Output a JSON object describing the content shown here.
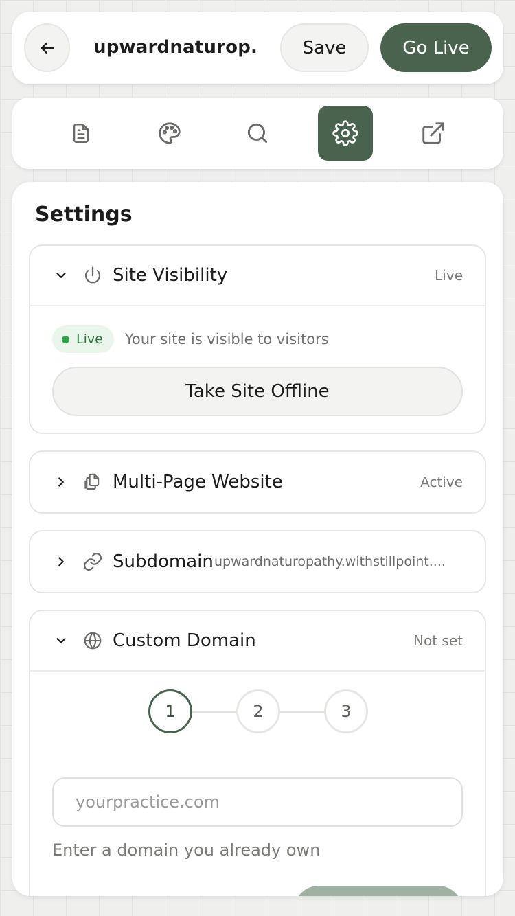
{
  "topbar": {
    "site_name": "upwardnaturop...",
    "save_label": "Save",
    "go_live_label": "Go Live"
  },
  "toolbar": {
    "tools": [
      {
        "icon": "document-icon",
        "active": false
      },
      {
        "icon": "palette-icon",
        "active": false
      },
      {
        "icon": "search-icon",
        "active": false
      },
      {
        "icon": "gear-icon",
        "active": true
      },
      {
        "icon": "external-link-icon",
        "active": false
      }
    ]
  },
  "settings": {
    "title": "Settings",
    "site_visibility": {
      "title": "Site Visibility",
      "status": "Live",
      "badge": "Live",
      "message": "Your site is visible to visitors",
      "action_label": "Take Site Offline"
    },
    "multi_page": {
      "title": "Multi-Page Website",
      "status": "Active"
    },
    "subdomain": {
      "title": "Subdomain",
      "value": "upwardnaturopathy.withstillpoint...."
    },
    "custom_domain": {
      "title": "Custom Domain",
      "status": "Not set",
      "steps": [
        "1",
        "2",
        "3"
      ],
      "current_step": 1,
      "input_placeholder": "yourpractice.com",
      "input_value": "",
      "helper": "Enter a domain you already own"
    }
  },
  "colors": {
    "accent": "#4a634f",
    "live_green": "#2ea24a",
    "background": "#efefed"
  }
}
